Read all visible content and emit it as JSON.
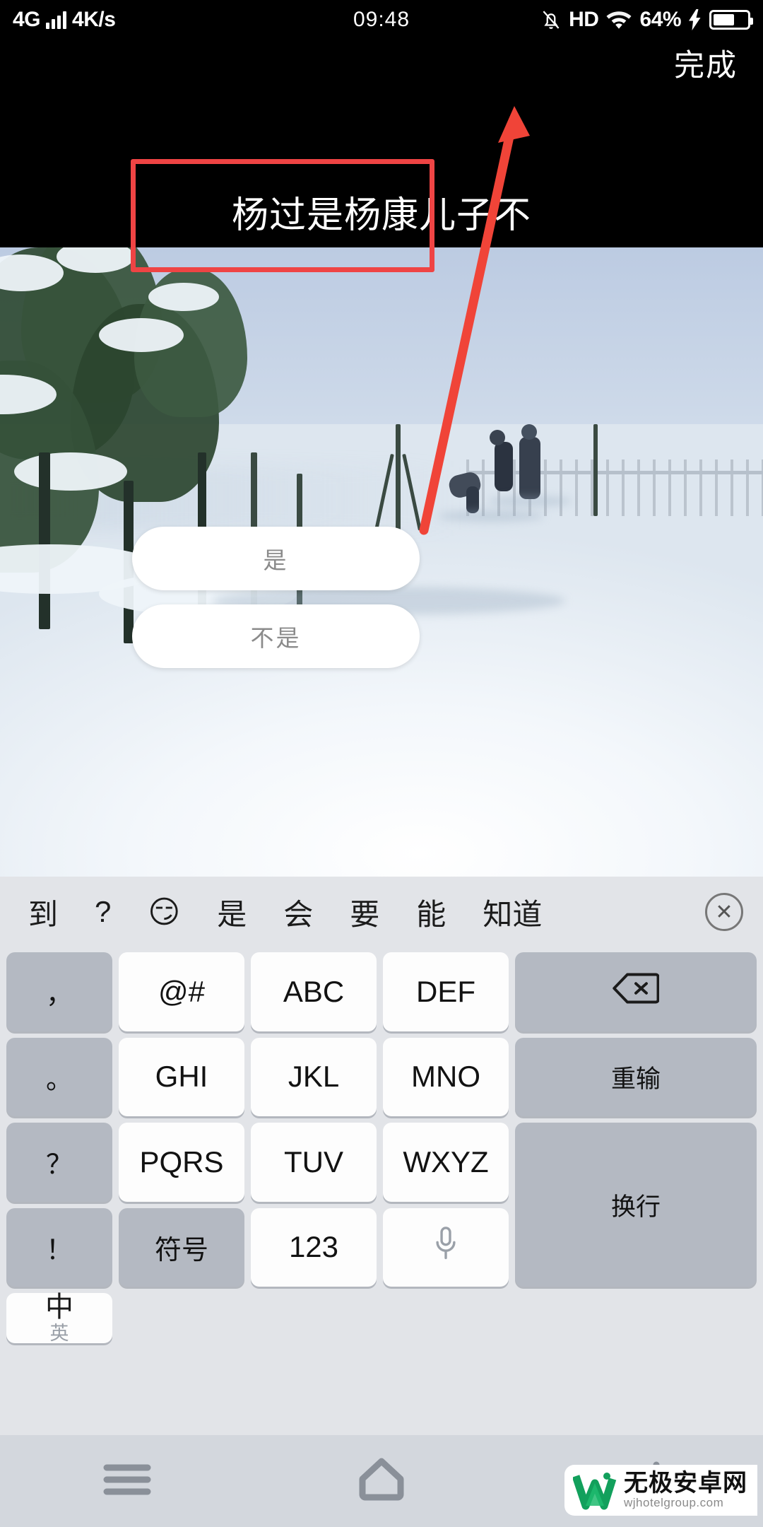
{
  "status_bar": {
    "network_type": "4G",
    "net_speed": "4K/s",
    "time": "09:48",
    "hd_label": "HD",
    "battery_percent": "64%",
    "battery_level": 64,
    "icons": [
      "signal-bars-icon",
      "mute-bell-icon",
      "hd-icon",
      "wifi-icon",
      "charging-bolt-icon",
      "battery-icon"
    ]
  },
  "header": {
    "done_label": "完成"
  },
  "compose": {
    "text": "杨过是杨康儿子不"
  },
  "choices": [
    {
      "label": "是"
    },
    {
      "label": "不是"
    }
  ],
  "annotation": {
    "box_color": "#ef4444",
    "arrow_color": "#f04438"
  },
  "keyboard": {
    "suggestions": [
      "到",
      "?",
      "😏",
      "是",
      "会",
      "要",
      "能",
      "知道"
    ],
    "close_icon": "✕",
    "rows": [
      [
        {
          "label": "，",
          "style": "gray",
          "name": "key-comma"
        },
        {
          "label": "@#",
          "style": "white",
          "name": "key-at-hash"
        },
        {
          "label": "ABC",
          "style": "white",
          "name": "key-abc"
        },
        {
          "label": "DEF",
          "style": "white",
          "name": "key-def"
        },
        {
          "label": "",
          "style": "gray",
          "name": "key-backspace",
          "icon": "backspace-icon"
        }
      ],
      [
        {
          "label": "。",
          "style": "gray",
          "name": "key-period"
        },
        {
          "label": "GHI",
          "style": "white",
          "name": "key-ghi"
        },
        {
          "label": "JKL",
          "style": "white",
          "name": "key-jkl"
        },
        {
          "label": "MNO",
          "style": "white",
          "name": "key-mno"
        },
        {
          "label": "重输",
          "style": "gray",
          "name": "key-retype"
        }
      ],
      [
        {
          "label": "？",
          "style": "gray",
          "name": "key-question"
        },
        {
          "label": "PQRS",
          "style": "white",
          "name": "key-pqrs"
        },
        {
          "label": "TUV",
          "style": "white",
          "name": "key-tuv"
        },
        {
          "label": "WXYZ",
          "style": "white",
          "name": "key-wxyz"
        },
        {
          "label": "换行",
          "style": "gray",
          "name": "key-newline"
        }
      ],
      [
        {
          "label": "！",
          "style": "gray",
          "name": "key-exclaim"
        },
        {
          "label": "符号",
          "style": "gray",
          "name": "key-symbols"
        },
        {
          "label": "123",
          "style": "white",
          "name": "key-123"
        },
        {
          "label": "",
          "style": "white",
          "name": "key-voice",
          "icon": "microphone-icon"
        },
        {
          "label": "中",
          "sub_label": "英",
          "style": "white",
          "name": "key-language-toggle"
        }
      ]
    ]
  },
  "nav_bar": {
    "items": [
      {
        "name": "nav-recents",
        "icon": "menu-icon"
      },
      {
        "name": "nav-home",
        "icon": "home-icon"
      },
      {
        "name": "nav-back",
        "icon": "back-icon"
      }
    ]
  },
  "watermark": {
    "name_cn": "无极安卓网",
    "url": "wjhotelgroup.com",
    "logo_color": "#12a05c"
  }
}
